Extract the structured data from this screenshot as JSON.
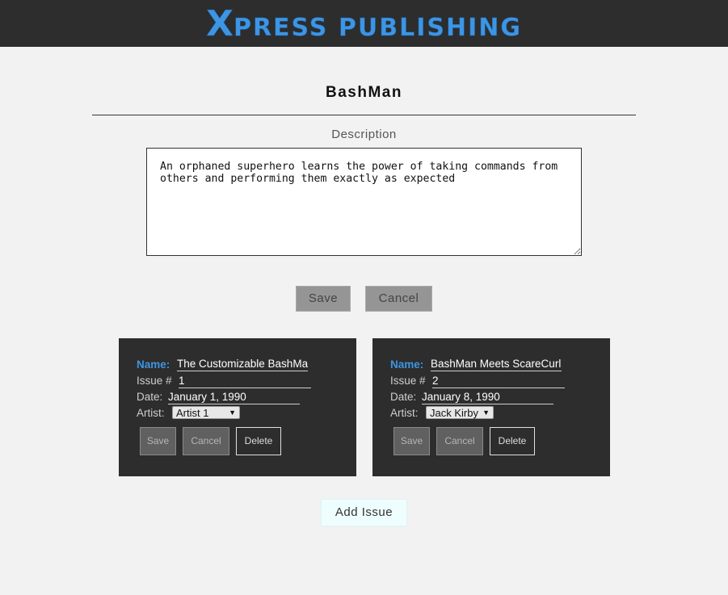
{
  "header": {
    "logo_initial": "X",
    "logo_rest": "PRESS PUBLISHING"
  },
  "series": {
    "title": "BashMan",
    "description_label": "Description",
    "description": "An orphaned superhero learns the power of taking commands from others and performing them exactly as expected",
    "save_label": "Save",
    "cancel_label": "Cancel"
  },
  "issues": [
    {
      "name_label": "Name:",
      "name": "The Customizable BashMan",
      "issue_label": "Issue #",
      "issue_number": "1",
      "date_label": "Date:",
      "date": "January 1, 1990",
      "artist_label": "Artist:",
      "artist": "Artist 1",
      "save_label": "Save",
      "cancel_label": "Cancel",
      "delete_label": "Delete"
    },
    {
      "name_label": "Name:",
      "name": "BashMan Meets ScareCurl",
      "issue_label": "Issue #",
      "issue_number": "2",
      "date_label": "Date:",
      "date": "January 8, 1990",
      "artist_label": "Artist:",
      "artist": "Jack Kirby",
      "save_label": "Save",
      "cancel_label": "Cancel",
      "delete_label": "Delete"
    }
  ],
  "add_issue_label": "Add Issue",
  "colors": {
    "accent": "#3d95e3",
    "header_bg": "#2d2d2d",
    "page_bg": "#f2f2f2"
  }
}
